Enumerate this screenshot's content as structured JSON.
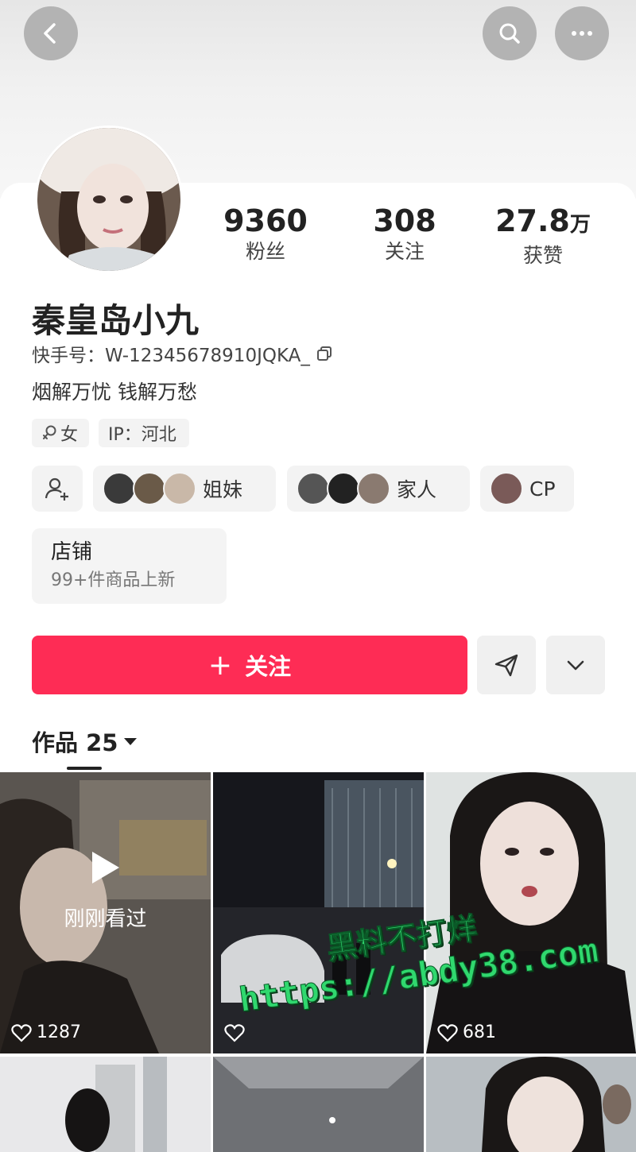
{
  "stats": [
    {
      "value": "9360",
      "unit": "",
      "label": "粉丝"
    },
    {
      "value": "308",
      "unit": "",
      "label": "关注"
    },
    {
      "value": "27.8",
      "unit": "万",
      "label": "获赞"
    }
  ],
  "profile": {
    "name": "秦皇岛小九",
    "uid": "快手号：W-12345678910JQKA_",
    "bio": "烟解万忧 钱解万愁",
    "gender_tag": "女",
    "ip_tag": "IP：河北"
  },
  "relations": [
    {
      "label": "姐妹"
    },
    {
      "label": "家人"
    },
    {
      "label": "CP"
    }
  ],
  "shop": {
    "title": "店铺",
    "subtitle": "99+件商品上新"
  },
  "actions": {
    "follow": "关注"
  },
  "works": {
    "label": "作品 25"
  },
  "tiles": [
    {
      "likes": "1287",
      "overlay": "刚刚看过"
    },
    {
      "likes": ""
    },
    {
      "likes": "681"
    }
  ],
  "watermark": {
    "line1": "黑料不打烊",
    "line2": "https://abdy38.com"
  },
  "colors": {
    "accent": "#fe2c55",
    "watermark": "#30d86e"
  }
}
